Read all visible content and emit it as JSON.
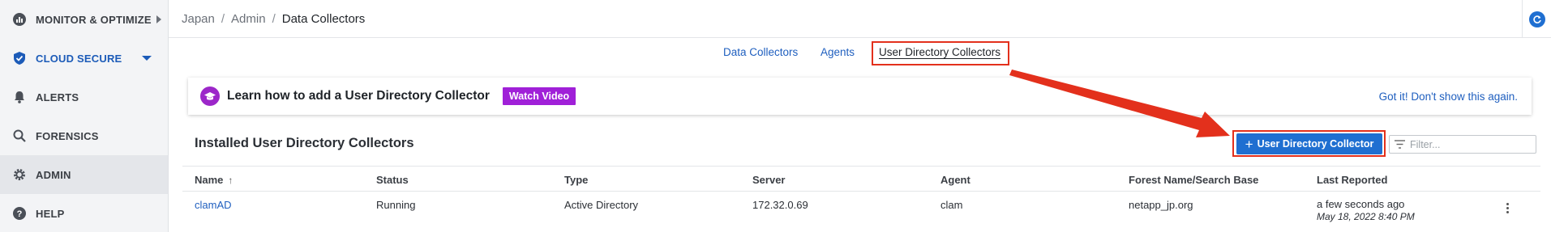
{
  "sidebar": {
    "items": [
      {
        "label": "MONITOR & OPTIMIZE",
        "icon": "dashboard-icon"
      },
      {
        "label": "CLOUD SECURE",
        "icon": "shield-icon"
      },
      {
        "label": "ALERTS",
        "icon": "bell-icon"
      },
      {
        "label": "FORENSICS",
        "icon": "search-icon"
      },
      {
        "label": "ADMIN",
        "icon": "gear-icon"
      },
      {
        "label": "HELP",
        "icon": "help-icon"
      }
    ]
  },
  "breadcrumb": {
    "items": [
      "Japan",
      "Admin"
    ],
    "current": "Data Collectors",
    "separator": "/"
  },
  "tabs": [
    {
      "label": "Data Collectors"
    },
    {
      "label": "Agents"
    },
    {
      "label": "User Directory Collectors",
      "active": true
    }
  ],
  "banner": {
    "text": "Learn how to add a User Directory Collector",
    "watch_label": "Watch Video",
    "dismiss_label": "Got it! Don't show this again."
  },
  "section": {
    "title": "Installed User Directory Collectors",
    "add_label": "User Directory Collector",
    "filter_placeholder": "Filter..."
  },
  "table": {
    "columns": [
      "Name",
      "Status",
      "Type",
      "Server",
      "Agent",
      "Forest Name/Search Base",
      "Last Reported"
    ],
    "sort_indicator": "↑",
    "rows": [
      {
        "name": "clamAD",
        "status": "Running",
        "type": "Active Directory",
        "server": "172.32.0.69",
        "agent": "clam",
        "forest": "netapp_jp.org",
        "last_reported": "a few seconds ago",
        "last_reported_date": "May 18, 2022 8:40 PM"
      }
    ]
  },
  "colors": {
    "accent": "#1f6fd1",
    "link": "#1f5fbf",
    "watch_button": "#a020d8",
    "highlight": "#e3301c"
  }
}
